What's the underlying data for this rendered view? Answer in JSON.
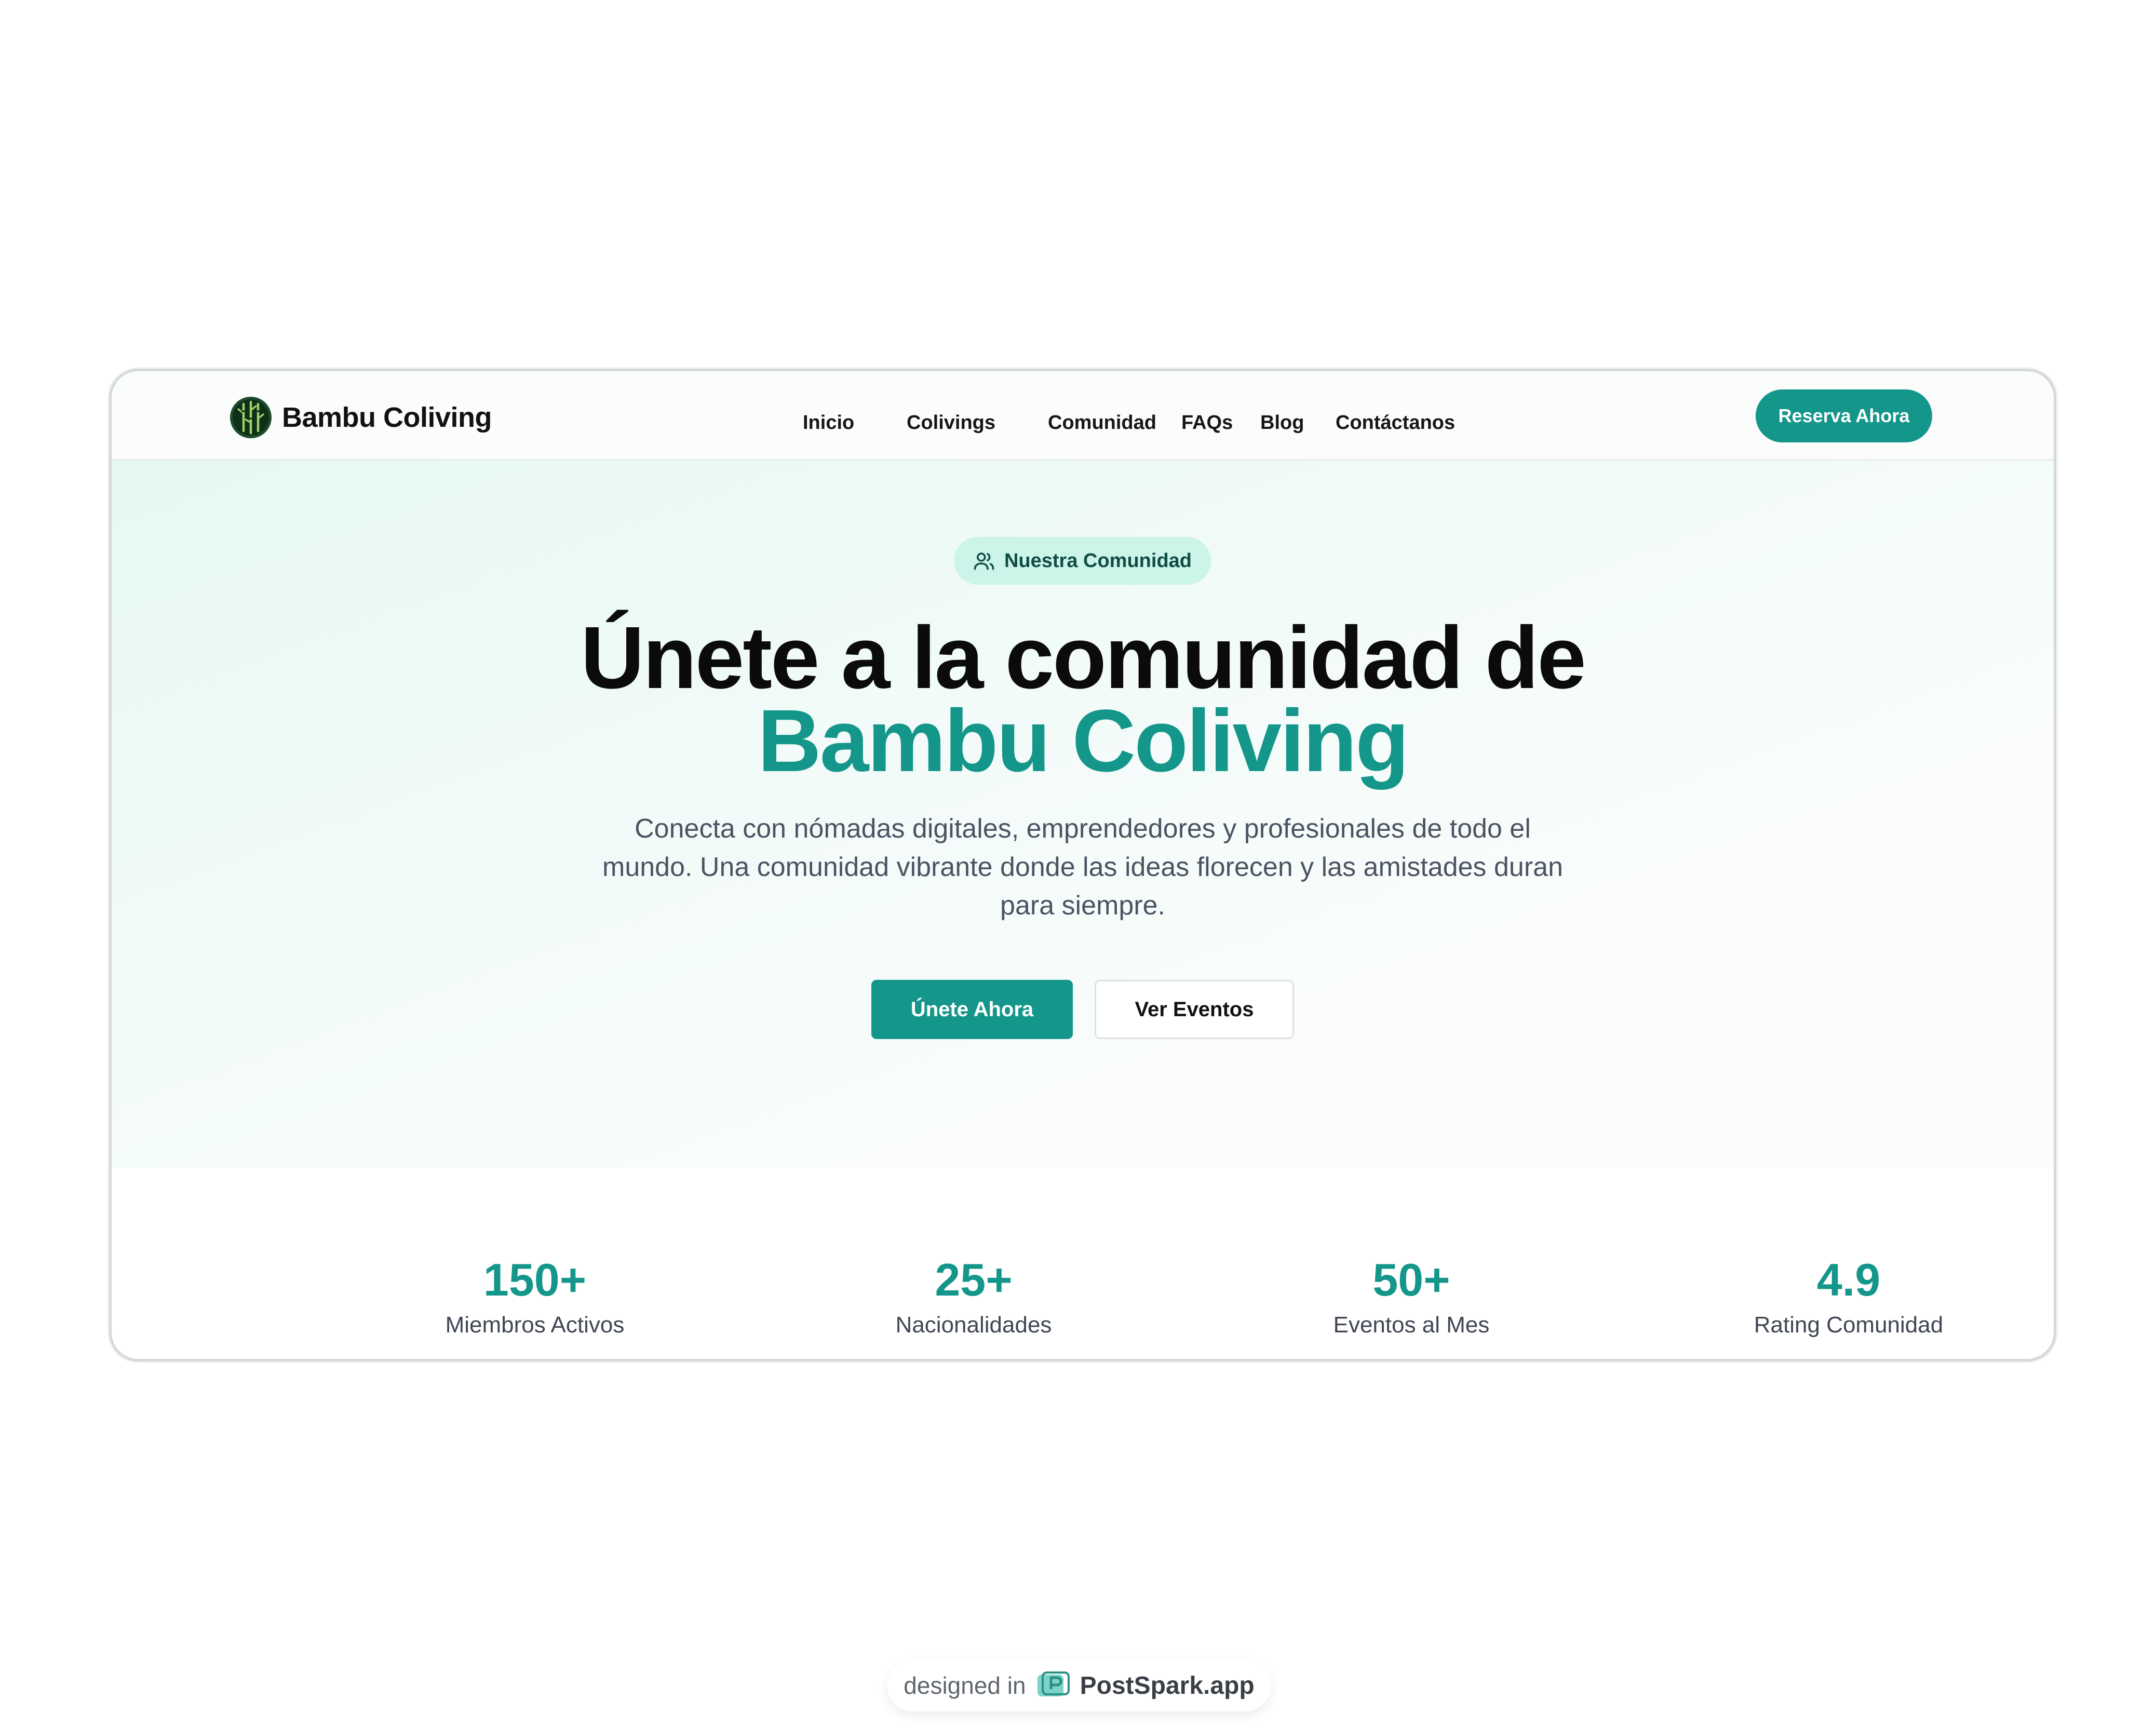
{
  "brand": {
    "name": "Bambu Coliving",
    "logo_icon": "bamboo-logo-icon"
  },
  "nav": {
    "items": [
      "Inicio",
      "Colivings",
      "Comunidad",
      "FAQs",
      "Blog",
      "Contáctanos"
    ],
    "cta": "Reserva Ahora"
  },
  "hero": {
    "badge": "Nuestra Comunidad",
    "badge_icon": "users-icon",
    "title_line1": "Únete a la comunidad de",
    "title_line2": "Bambu Coliving",
    "description": "Conecta con nómadas digitales, emprendedores y profesionales de todo el mundo. Una comunidad vibrante donde las ideas florecen y las amistades duran para siempre.",
    "primary_button": "Únete Ahora",
    "secondary_button": "Ver Eventos"
  },
  "stats": [
    {
      "value": "150+",
      "label": "Miembros Activos"
    },
    {
      "value": "25+",
      "label": "Nacionalidades"
    },
    {
      "value": "50+",
      "label": "Eventos al Mes"
    },
    {
      "value": "4.9",
      "label": "Rating Comunidad"
    }
  ],
  "footer": {
    "prefix": "designed in",
    "brand": "PostSpark.app",
    "icon": "postspark-icon"
  },
  "colors": {
    "accent": "#14968a",
    "badge_bg": "#ccf4e8",
    "text_dark": "#0b0b0b",
    "text_muted": "#4b5362"
  }
}
